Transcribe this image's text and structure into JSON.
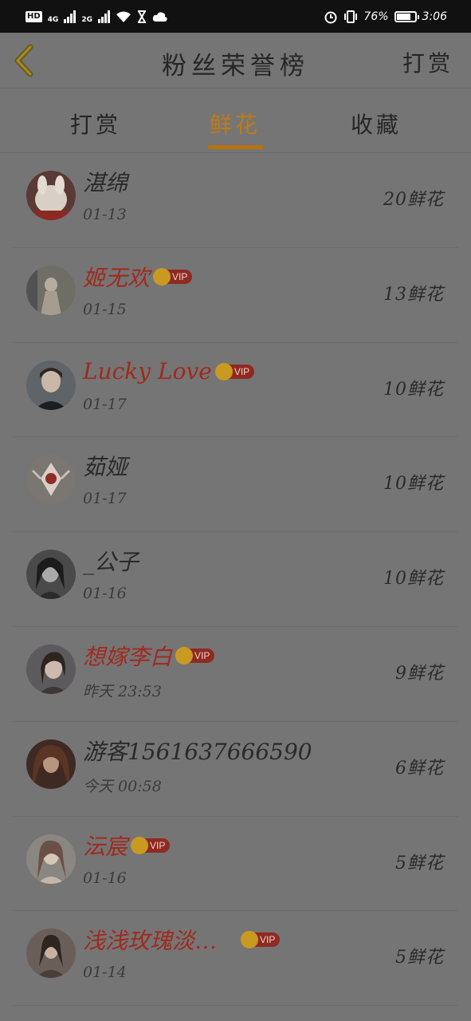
{
  "status_bar": {
    "hd": "HD",
    "net1": "4G",
    "net2": "2G",
    "battery": "76%",
    "time": "3:06"
  },
  "header": {
    "title": "粉丝荣誉榜",
    "action": "打赏"
  },
  "tabs": [
    {
      "label": "打赏",
      "active": false
    },
    {
      "label": "鲜花",
      "active": true
    },
    {
      "label": "收藏",
      "active": false
    }
  ],
  "vip_label": "VIP",
  "fans": [
    {
      "name": "湛绵",
      "vip": false,
      "date": "01-13",
      "count": "20鲜花"
    },
    {
      "name": "姬无欢",
      "vip": true,
      "date": "01-15",
      "count": "13鲜花"
    },
    {
      "name": "Lucky Love",
      "vip": true,
      "date": "01-17",
      "count": "10鲜花"
    },
    {
      "name": "茹娅",
      "vip": false,
      "date": "01-17",
      "count": "10鲜花"
    },
    {
      "name": "_公子",
      "vip": false,
      "date": "01-16",
      "count": "10鲜花"
    },
    {
      "name": "想嫁李白",
      "vip": true,
      "date": "昨天 23:53",
      "count": "9鲜花"
    },
    {
      "name": "游客1561637666590",
      "vip": false,
      "date": "今天 00:58",
      "count": "6鲜花"
    },
    {
      "name": "沄宸",
      "vip": true,
      "date": "01-16",
      "count": "5鲜花"
    },
    {
      "name": "浅浅玫瑰淡…",
      "vip": true,
      "date": "01-14",
      "count": "5鲜花"
    }
  ],
  "colors": {
    "accent": "#c07a14",
    "vip_name": "#a02a1e",
    "overlay_bg": "#757575"
  }
}
